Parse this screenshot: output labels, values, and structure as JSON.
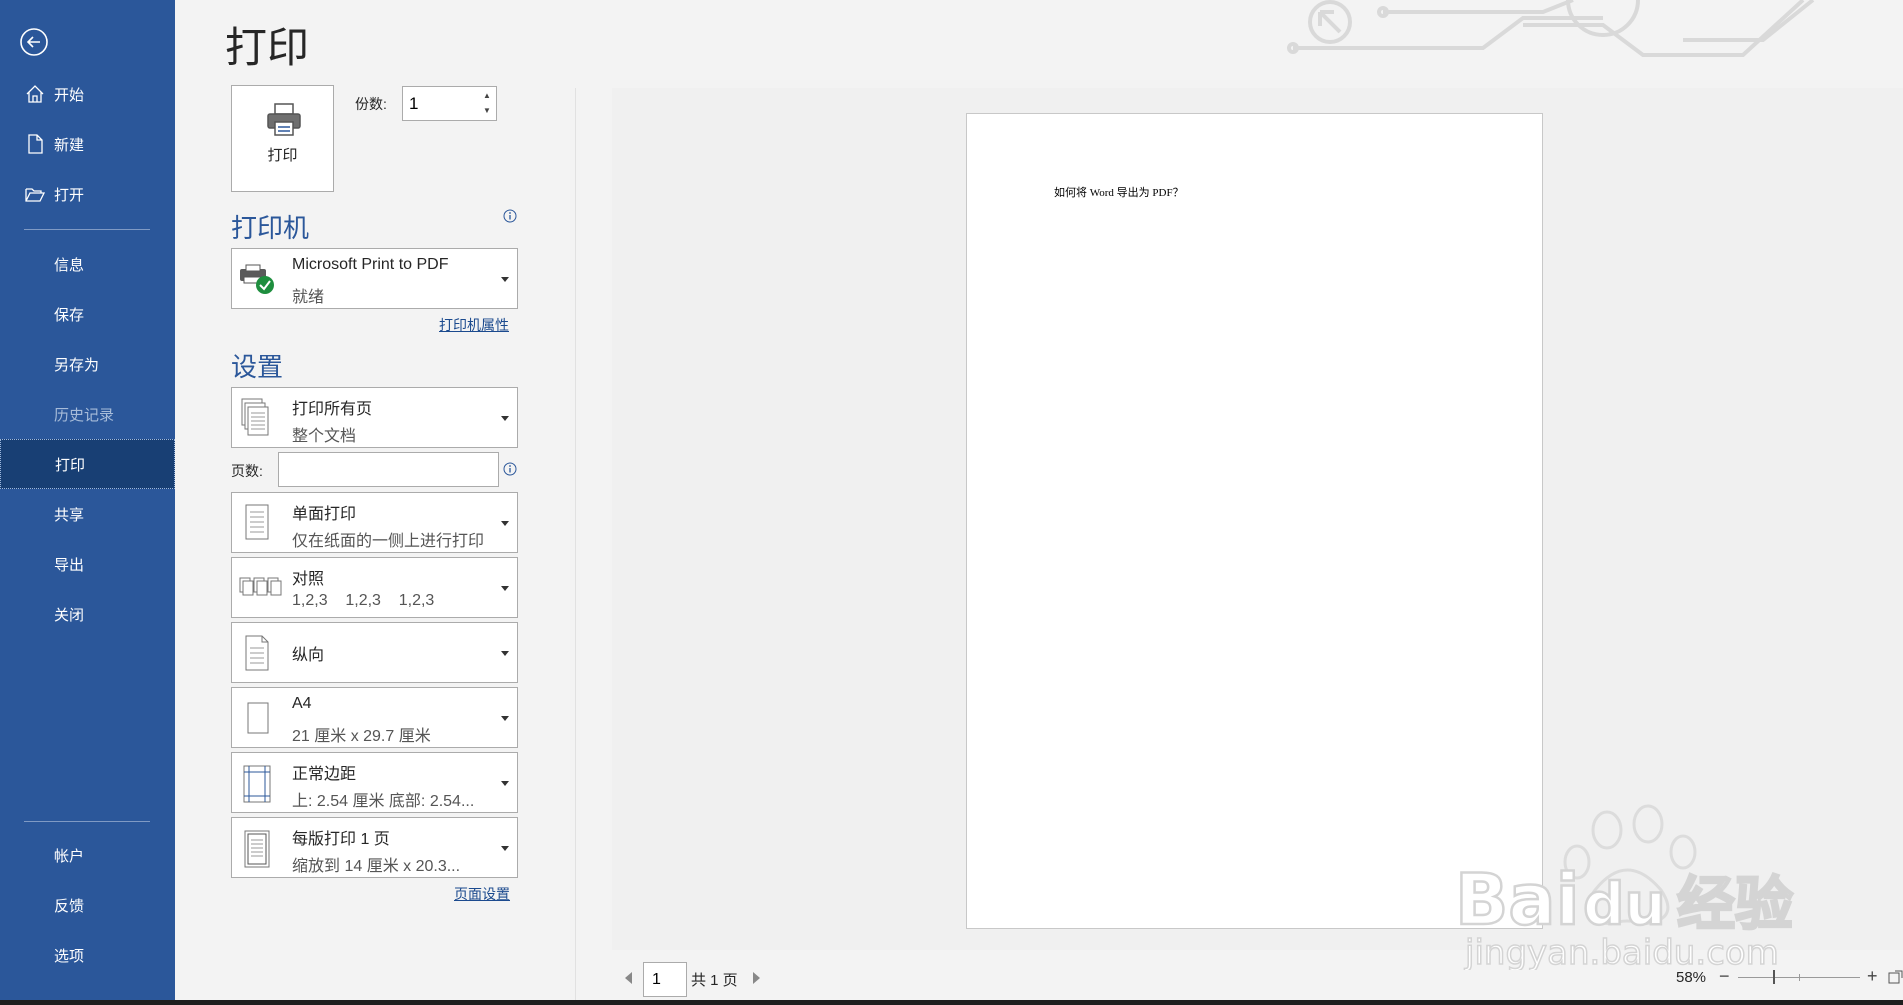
{
  "title": "打印",
  "sidebar": {
    "items": [
      {
        "label": "开始",
        "icon": "home-icon"
      },
      {
        "label": "新建",
        "icon": "new-document-icon"
      },
      {
        "label": "打开",
        "icon": "open-folder-icon"
      },
      {
        "label": "信息"
      },
      {
        "label": "保存"
      },
      {
        "label": "另存为"
      },
      {
        "label": "历史记录",
        "disabled": true
      },
      {
        "label": "打印",
        "active": true
      },
      {
        "label": "共享"
      },
      {
        "label": "导出"
      },
      {
        "label": "关闭"
      },
      {
        "label": "帐户"
      },
      {
        "label": "反馈"
      },
      {
        "label": "选项"
      }
    ]
  },
  "print_button": {
    "label": "打印"
  },
  "copies": {
    "label": "份数:",
    "value": "1"
  },
  "printer": {
    "section_title": "打印机",
    "name": "Microsoft Print to PDF",
    "status": "就绪",
    "properties_link": "打印机属性"
  },
  "settings": {
    "section_title": "设置",
    "print_range": {
      "line1": "打印所有页",
      "line2": "整个文档"
    },
    "pages": {
      "label": "页数:",
      "value": ""
    },
    "sides": {
      "line1": "单面打印",
      "line2": "仅在纸面的一侧上进行打印"
    },
    "collate": {
      "line1": "对照",
      "line2": "1,2,3    1,2,3    1,2,3"
    },
    "orientation": {
      "line1": "纵向"
    },
    "paper_size": {
      "line1": "A4",
      "line2": "21 厘米 x 29.7 厘米"
    },
    "margins": {
      "line1": "正常边距",
      "line2": "上: 2.54 厘米 底部: 2.54..."
    },
    "pages_per_sheet": {
      "line1": "每版打印 1 页",
      "line2": "缩放到 14 厘米 x 20.3..."
    },
    "page_setup_link": "页面设置"
  },
  "preview": {
    "document_text": "如何将 Word 导出为 PDF？",
    "current_page": "1",
    "total_pages": "共 1 页",
    "zoom": "58%",
    "zoom_level_percent": 58
  },
  "watermark": {
    "brand": "Bai",
    "brand2": "du",
    "cn": "经验",
    "url": "jingyan.baidu.com"
  },
  "colors": {
    "sidebar": "#2b579a",
    "sidebar_active": "#183f74",
    "accent": "#2b579a"
  }
}
